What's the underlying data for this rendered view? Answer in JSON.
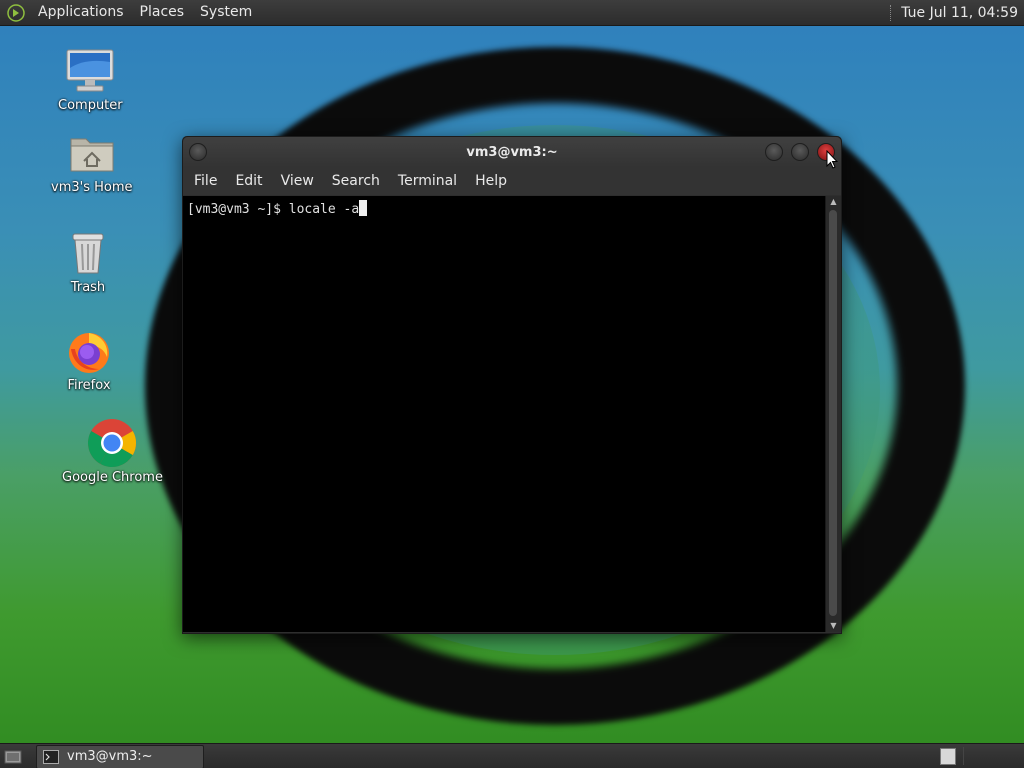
{
  "top_panel": {
    "menus": [
      "Applications",
      "Places",
      "System"
    ],
    "clock": "Tue Jul 11, 04:59"
  },
  "desktop_icons": [
    {
      "label": "Computer",
      "icon": "computer-icon"
    },
    {
      "label": "vm3's Home",
      "icon": "home-folder-icon"
    },
    {
      "label": "Trash",
      "icon": "trash-icon"
    },
    {
      "label": "Firefox",
      "icon": "firefox-icon"
    },
    {
      "label": "Google Chrome",
      "icon": "chrome-icon"
    }
  ],
  "terminal": {
    "title": "vm3@vm3:~",
    "menus": [
      "File",
      "Edit",
      "View",
      "Search",
      "Terminal",
      "Help"
    ],
    "prompt_line": "[vm3@vm3 ~]$ locale -a"
  },
  "taskbar": {
    "task_label": "vm3@vm3:~"
  },
  "colors": {
    "panel": "#2c2c2c",
    "terminal_bg": "#000000",
    "close_button": "#e04040"
  }
}
